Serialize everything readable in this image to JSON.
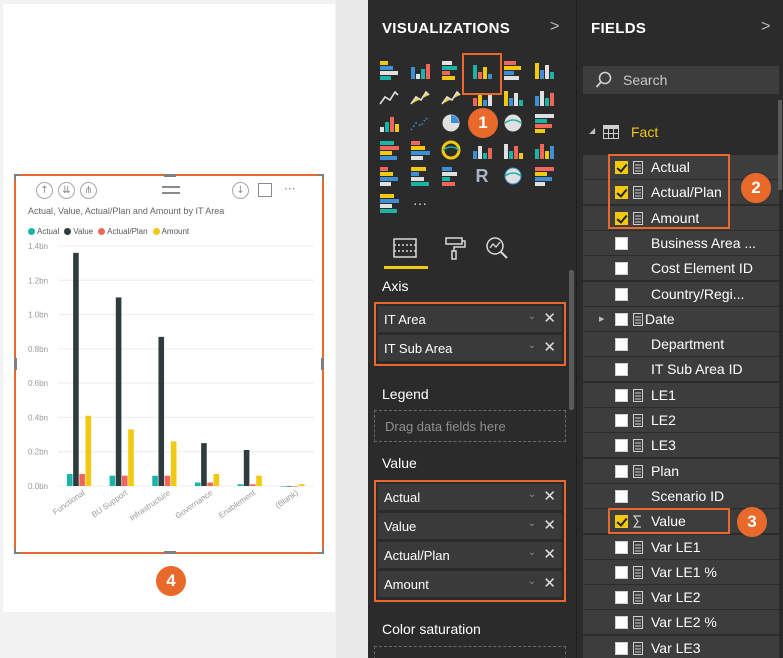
{
  "badges": {
    "one": "1",
    "two": "2",
    "three": "3",
    "four": "4"
  },
  "visual": {
    "title": "Actual, Value, Actual/Plan and Amount by IT Area",
    "more": "···"
  },
  "chart_data": {
    "type": "bar",
    "title": "Actual, Value, Actual/Plan and Amount by IT Area",
    "categories": [
      "Functional",
      "BU Support",
      "Infrastructure",
      "Governance",
      "Enablement",
      "(Blank)"
    ],
    "series": [
      {
        "name": "Actual",
        "color": "#1ab4a6",
        "values": [
          0.07,
          0.06,
          0.06,
          0.02,
          0.01,
          0.0
        ]
      },
      {
        "name": "Value",
        "color": "#2f3c3d",
        "values": [
          1.36,
          1.1,
          0.87,
          0.25,
          0.21,
          0.0
        ]
      },
      {
        "name": "Actual/Plan",
        "color": "#f26659",
        "values": [
          0.07,
          0.06,
          0.06,
          0.02,
          0.01,
          0.0
        ]
      },
      {
        "name": "Amount",
        "color": "#f2c811",
        "values": [
          0.41,
          0.33,
          0.26,
          0.07,
          0.06,
          0.01
        ]
      }
    ],
    "yticks": [
      "0.0bn",
      "0.2bn",
      "0.4bn",
      "0.6bn",
      "0.8bn",
      "1.0bn",
      "1.2bn",
      "1.4bn"
    ],
    "ylim": [
      0,
      1.4
    ],
    "grid": true,
    "legend": "top-left"
  },
  "viz": {
    "title": "VISUALIZATIONS",
    "chevron": ">",
    "icons": [
      "stacked-bar",
      "stacked-column",
      "clustered-bar",
      "clustered-column",
      "100-bar",
      "100-column",
      "line",
      "area",
      "stacked-area",
      "line-column",
      "line-clustered-column",
      "ribbon",
      "waterfall",
      "scatter",
      "pie",
      "treemap",
      "map",
      "filled-map",
      "shape-map",
      "funnel",
      "gauge",
      "card",
      "multi-row-card",
      "kpi",
      "slicer",
      "table",
      "matrix",
      "r-visual",
      "globe",
      "custom-1",
      "custom-2",
      "more"
    ],
    "more_glyph": "···",
    "r_letter": "R",
    "axis_label": "Axis",
    "axis_wells": [
      "IT Area",
      "IT Sub Area"
    ],
    "legend_label": "Legend",
    "legend_placeholder": "Drag data fields here",
    "value_label": "Value",
    "value_wells": [
      "Actual",
      "Value",
      "Actual/Plan",
      "Amount"
    ],
    "color_saturation_label": "Color saturation",
    "chevron_glyph": "⌄",
    "remove_glyph": "✕"
  },
  "fields": {
    "title": "FIELDS",
    "chevron": ">",
    "search_placeholder": "Search",
    "table_name": "Fact",
    "items": [
      {
        "name": "Actual",
        "checked": true,
        "icon": "calc"
      },
      {
        "name": "Actual/Plan",
        "checked": true,
        "icon": "calc"
      },
      {
        "name": "Amount",
        "checked": true,
        "icon": "calc"
      },
      {
        "name": "Business Area ...",
        "checked": false,
        "icon": "none"
      },
      {
        "name": "Cost Element ID",
        "checked": false,
        "icon": "none"
      },
      {
        "name": "Country/Regi...",
        "checked": false,
        "icon": "none"
      },
      {
        "name": "Date",
        "checked": false,
        "icon": "date",
        "expandable": true
      },
      {
        "name": "Department",
        "checked": false,
        "icon": "none"
      },
      {
        "name": "IT Sub Area ID",
        "checked": false,
        "icon": "none"
      },
      {
        "name": "LE1",
        "checked": false,
        "icon": "calc"
      },
      {
        "name": "LE2",
        "checked": false,
        "icon": "calc"
      },
      {
        "name": "LE3",
        "checked": false,
        "icon": "calc"
      },
      {
        "name": "Plan",
        "checked": false,
        "icon": "calc"
      },
      {
        "name": "Scenario ID",
        "checked": false,
        "icon": "none"
      },
      {
        "name": "Value",
        "checked": true,
        "icon": "sigma"
      },
      {
        "name": "Var LE1",
        "checked": false,
        "icon": "calc"
      },
      {
        "name": "Var LE1 %",
        "checked": false,
        "icon": "calc"
      },
      {
        "name": "Var LE2",
        "checked": false,
        "icon": "calc"
      },
      {
        "name": "Var LE2 %",
        "checked": false,
        "icon": "calc"
      },
      {
        "name": "Var LE3",
        "checked": false,
        "icon": "calc"
      }
    ]
  },
  "colors": {
    "accent_orange": "#e8692a",
    "pane_bg": "#2b2b2b",
    "field_bg": "#3d3d3d",
    "yellow": "#f2c811"
  }
}
